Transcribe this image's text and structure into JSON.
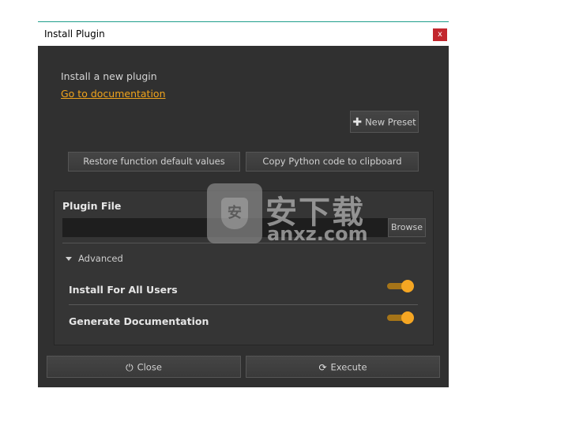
{
  "window": {
    "title": "Install Plugin",
    "close_label": "x"
  },
  "content": {
    "intro": "Install a new plugin",
    "doc_link": "Go to documentation",
    "new_preset_label": "New Preset",
    "restore_label": "Restore function default values",
    "copy_label": "Copy Python code to clipboard"
  },
  "panel": {
    "plugin_file_label": "Plugin File",
    "file_value": "",
    "browse_label": "Browse",
    "advanced_label": "Advanced",
    "options": [
      {
        "label": "Install For All Users",
        "enabled": true
      },
      {
        "label": "Generate Documentation",
        "enabled": true
      }
    ]
  },
  "footer": {
    "close_label": "Close",
    "execute_label": "Execute"
  },
  "watermark": {
    "text_cn": "安下载",
    "text_url": "anxz.com"
  },
  "colors": {
    "accent": "#f5a623",
    "link": "#f0a41c",
    "close_button": "#c2272d",
    "background": "#303030"
  }
}
